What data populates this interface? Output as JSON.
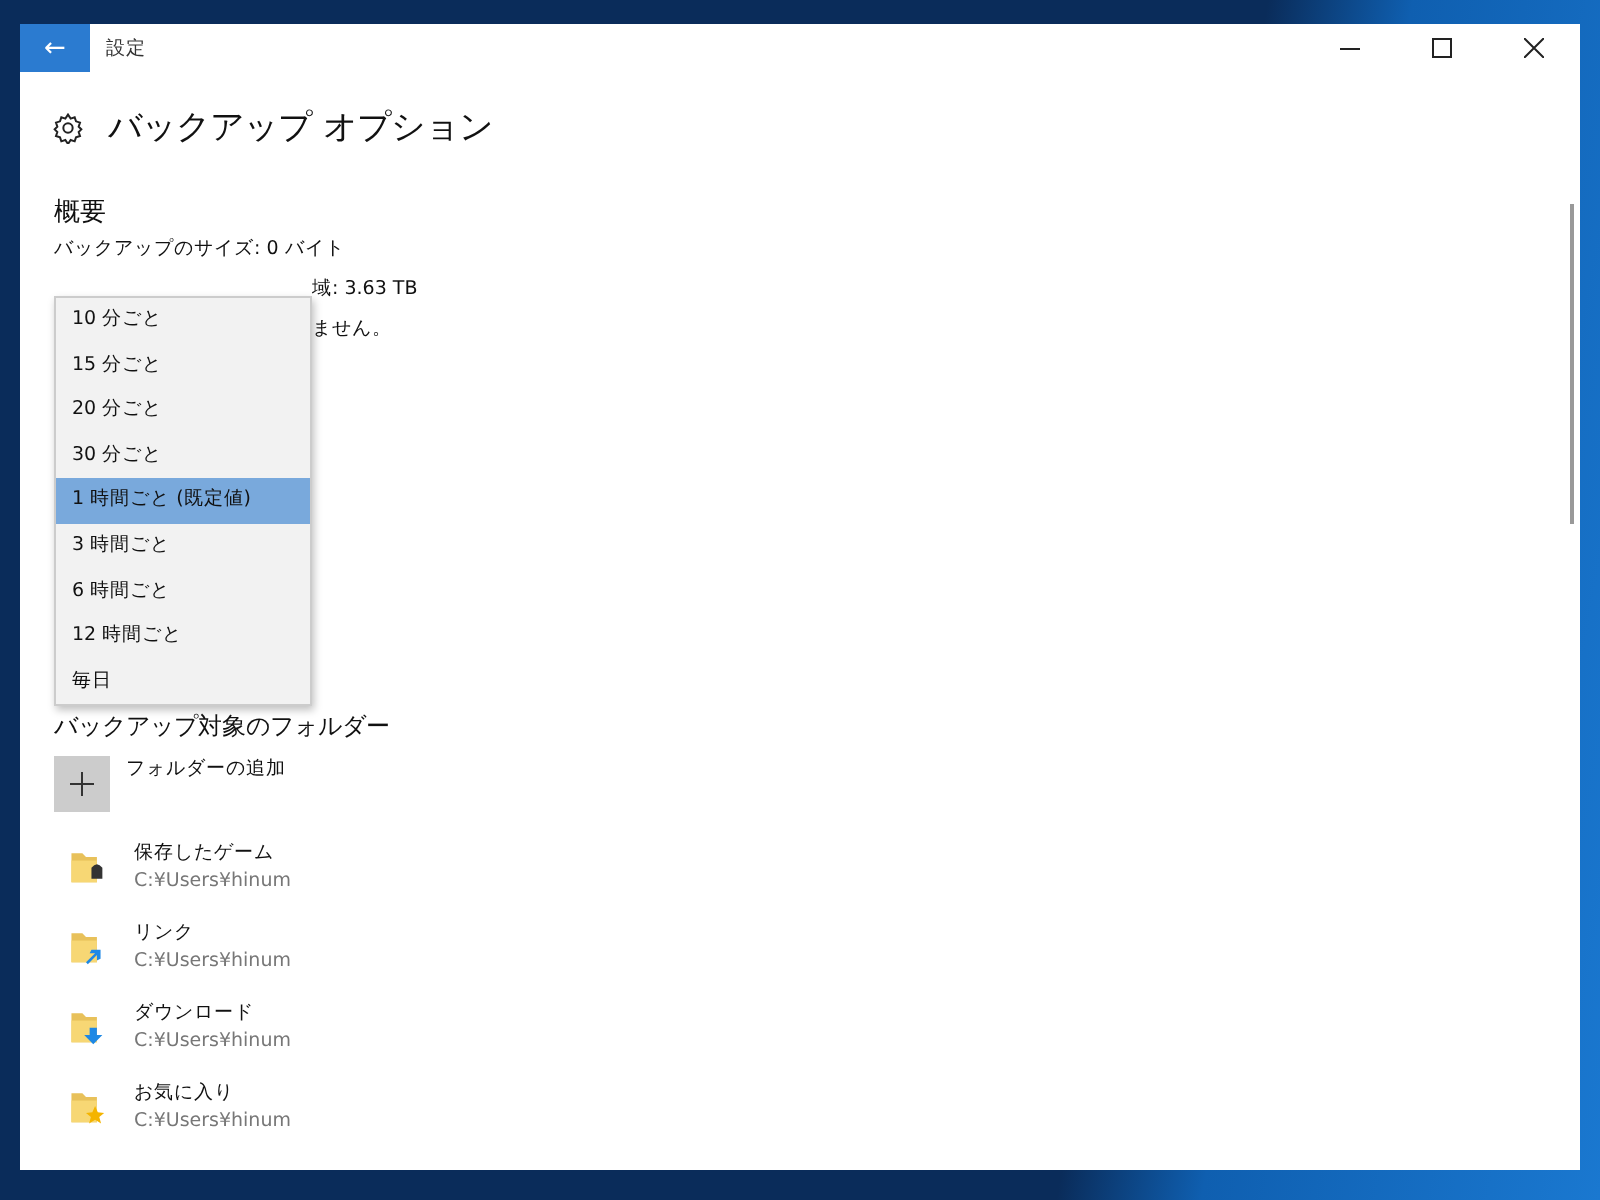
{
  "window": {
    "title": "設定",
    "back_glyph": "←"
  },
  "page": {
    "title": "バックアップ オプション"
  },
  "overview": {
    "heading": "概要",
    "lines": [
      {
        "kind": "full",
        "text": "バックアップのサイズ: 0 バイト"
      },
      {
        "kind": "covered",
        "text": "域: 3.63 TB"
      },
      {
        "kind": "covered",
        "text": "ません。"
      }
    ]
  },
  "frequency_menu": {
    "items": [
      {
        "label": "10 分ごと",
        "selected": false
      },
      {
        "label": "15 分ごと",
        "selected": false
      },
      {
        "label": "20 分ごと",
        "selected": false
      },
      {
        "label": "30 分ごと",
        "selected": false
      },
      {
        "label": "1 時間ごと (既定値)",
        "selected": true
      },
      {
        "label": "3 時間ごと",
        "selected": false
      },
      {
        "label": "6 時間ごと",
        "selected": false
      },
      {
        "label": "12 時間ごと",
        "selected": false
      },
      {
        "label": "毎日",
        "selected": false
      }
    ]
  },
  "folders": {
    "heading": "バックアップ対象のフォルダー",
    "add_label": "フォルダーの追加",
    "items": [
      {
        "kind": "game",
        "name": "保存したゲーム",
        "path": "C:¥Users¥hinum"
      },
      {
        "kind": "link",
        "name": "リンク",
        "path": "C:¥Users¥hinum"
      },
      {
        "kind": "download",
        "name": "ダウンロード",
        "path": "C:¥Users¥hinum"
      },
      {
        "kind": "favorite",
        "name": "お気に入り",
        "path": "C:¥Users¥hinum"
      }
    ]
  }
}
